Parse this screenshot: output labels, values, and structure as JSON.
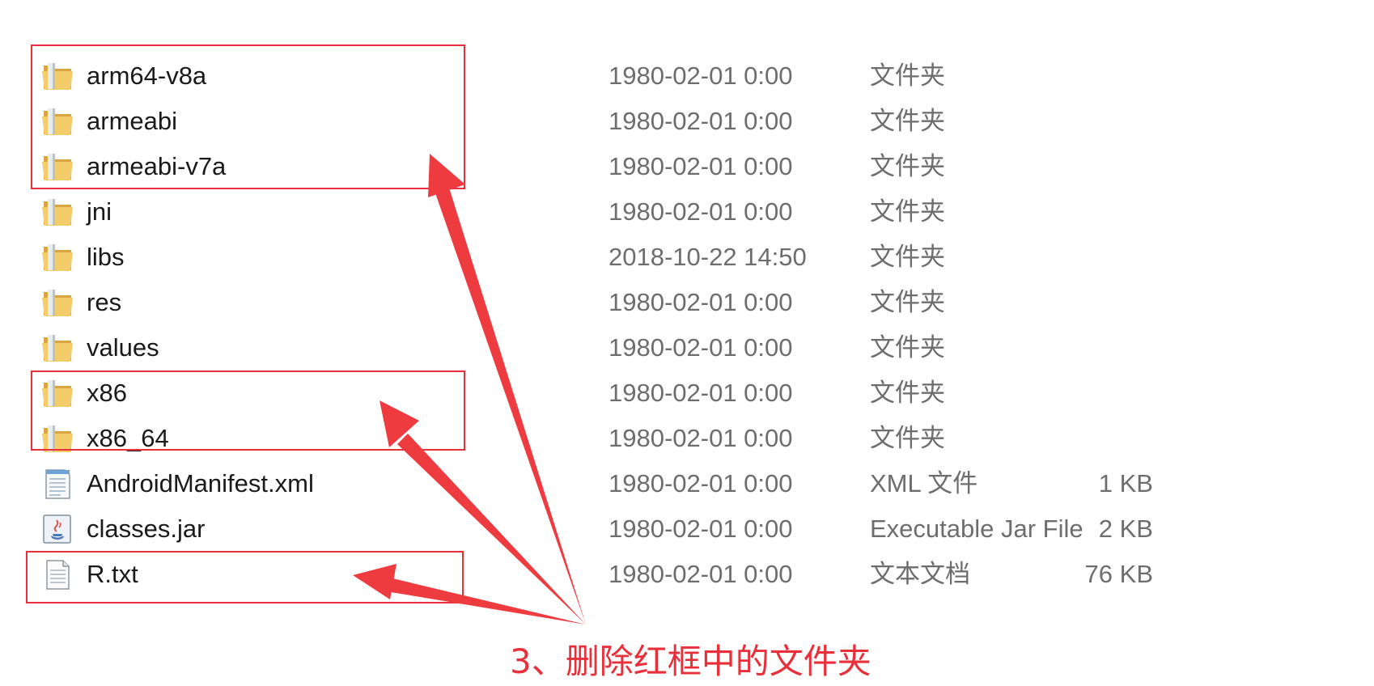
{
  "files": [
    {
      "name": "arm64-v8a",
      "date": "1980-02-01 0:00",
      "type": "文件夹",
      "size": "",
      "icon": "folder-icon"
    },
    {
      "name": "armeabi",
      "date": "1980-02-01 0:00",
      "type": "文件夹",
      "size": "",
      "icon": "folder-icon"
    },
    {
      "name": "armeabi-v7a",
      "date": "1980-02-01 0:00",
      "type": "文件夹",
      "size": "",
      "icon": "folder-icon"
    },
    {
      "name": "jni",
      "date": "1980-02-01 0:00",
      "type": "文件夹",
      "size": "",
      "icon": "folder-icon"
    },
    {
      "name": "libs",
      "date": "2018-10-22 14:50",
      "type": "文件夹",
      "size": "",
      "icon": "folder-icon"
    },
    {
      "name": "res",
      "date": "1980-02-01 0:00",
      "type": "文件夹",
      "size": "",
      "icon": "folder-icon"
    },
    {
      "name": "values",
      "date": "1980-02-01 0:00",
      "type": "文件夹",
      "size": "",
      "icon": "folder-icon"
    },
    {
      "name": "x86",
      "date": "1980-02-01 0:00",
      "type": "文件夹",
      "size": "",
      "icon": "folder-icon"
    },
    {
      "name": "x86_64",
      "date": "1980-02-01 0:00",
      "type": "文件夹",
      "size": "",
      "icon": "folder-icon"
    },
    {
      "name": "AndroidManifest.xml",
      "date": "1980-02-01 0:00",
      "type": "XML 文件",
      "size": "1 KB",
      "icon": "xml-file-icon"
    },
    {
      "name": "classes.jar",
      "date": "1980-02-01 0:00",
      "type": "Executable Jar File",
      "size": "2 KB",
      "icon": "java-jar-icon"
    },
    {
      "name": "R.txt",
      "date": "1980-02-01 0:00",
      "type": "文本文档",
      "size": "76 KB",
      "icon": "text-file-icon"
    }
  ],
  "annotation": {
    "note": "3、删除红框中的文件夹",
    "color": "#e8303a"
  }
}
